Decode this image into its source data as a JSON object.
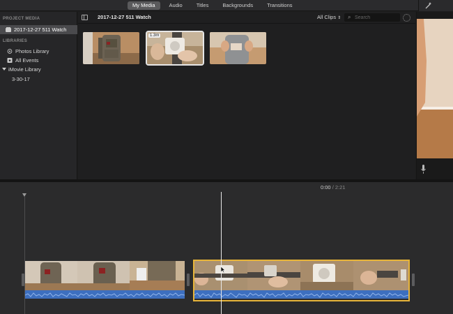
{
  "toolbar": {
    "tabs": [
      {
        "label": "My Media",
        "active": true
      },
      {
        "label": "Audio",
        "active": false
      },
      {
        "label": "Titles",
        "active": false
      },
      {
        "label": "Backgrounds",
        "active": false
      },
      {
        "label": "Transitions",
        "active": false
      }
    ],
    "enhance_icon": "magic-wand-icon"
  },
  "sidebar": {
    "project_media_header": "PROJECT MEDIA",
    "project_item": "2017-12-27 511 Watch",
    "libraries_header": "LIBRARIES",
    "photos_library": "Photos Library",
    "all_events": "All Events",
    "imovie_library": "iMovie Library",
    "event_item": "3-30-17"
  },
  "browser": {
    "event_title": "2017-12-27 511 Watch",
    "clips_filter": "All Clips",
    "search_placeholder": "Search",
    "thumbnails": [
      {
        "subject": "tactical backpack"
      },
      {
        "subject": "watch on strap",
        "duration": "1.3m",
        "selected": true
      },
      {
        "subject": "person with phone"
      }
    ]
  },
  "timeline": {
    "current_time": "0:00",
    "separator": "/",
    "total_time": "2:21",
    "clips": [
      {
        "subject": "backpack",
        "selected": false
      },
      {
        "subject": "watch unboxing",
        "selected": true
      }
    ]
  },
  "colors": {
    "selection_yellow": "#e8b53a",
    "audio_blue": "#3d6fbf",
    "active_tab": "#5a5a5c"
  }
}
